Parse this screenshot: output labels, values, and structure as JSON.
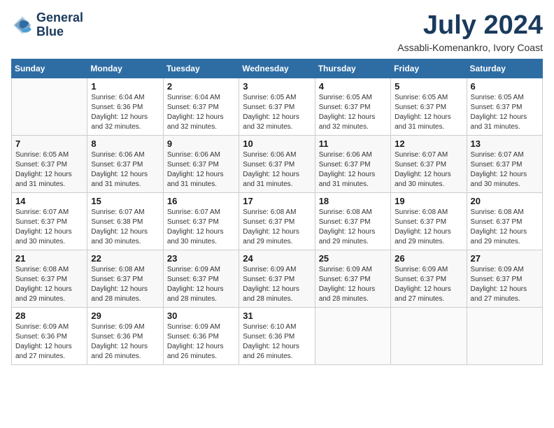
{
  "header": {
    "logo_line1": "General",
    "logo_line2": "Blue",
    "month_year": "July 2024",
    "location": "Assabli-Komenankro, Ivory Coast"
  },
  "weekdays": [
    "Sunday",
    "Monday",
    "Tuesday",
    "Wednesday",
    "Thursday",
    "Friday",
    "Saturday"
  ],
  "weeks": [
    [
      {
        "day": "",
        "info": ""
      },
      {
        "day": "1",
        "info": "Sunrise: 6:04 AM\nSunset: 6:36 PM\nDaylight: 12 hours\nand 32 minutes."
      },
      {
        "day": "2",
        "info": "Sunrise: 6:04 AM\nSunset: 6:37 PM\nDaylight: 12 hours\nand 32 minutes."
      },
      {
        "day": "3",
        "info": "Sunrise: 6:05 AM\nSunset: 6:37 PM\nDaylight: 12 hours\nand 32 minutes."
      },
      {
        "day": "4",
        "info": "Sunrise: 6:05 AM\nSunset: 6:37 PM\nDaylight: 12 hours\nand 32 minutes."
      },
      {
        "day": "5",
        "info": "Sunrise: 6:05 AM\nSunset: 6:37 PM\nDaylight: 12 hours\nand 31 minutes."
      },
      {
        "day": "6",
        "info": "Sunrise: 6:05 AM\nSunset: 6:37 PM\nDaylight: 12 hours\nand 31 minutes."
      }
    ],
    [
      {
        "day": "7",
        "info": "Sunrise: 6:05 AM\nSunset: 6:37 PM\nDaylight: 12 hours\nand 31 minutes."
      },
      {
        "day": "8",
        "info": "Sunrise: 6:06 AM\nSunset: 6:37 PM\nDaylight: 12 hours\nand 31 minutes."
      },
      {
        "day": "9",
        "info": "Sunrise: 6:06 AM\nSunset: 6:37 PM\nDaylight: 12 hours\nand 31 minutes."
      },
      {
        "day": "10",
        "info": "Sunrise: 6:06 AM\nSunset: 6:37 PM\nDaylight: 12 hours\nand 31 minutes."
      },
      {
        "day": "11",
        "info": "Sunrise: 6:06 AM\nSunset: 6:37 PM\nDaylight: 12 hours\nand 31 minutes."
      },
      {
        "day": "12",
        "info": "Sunrise: 6:07 AM\nSunset: 6:37 PM\nDaylight: 12 hours\nand 30 minutes."
      },
      {
        "day": "13",
        "info": "Sunrise: 6:07 AM\nSunset: 6:37 PM\nDaylight: 12 hours\nand 30 minutes."
      }
    ],
    [
      {
        "day": "14",
        "info": "Sunrise: 6:07 AM\nSunset: 6:37 PM\nDaylight: 12 hours\nand 30 minutes."
      },
      {
        "day": "15",
        "info": "Sunrise: 6:07 AM\nSunset: 6:38 PM\nDaylight: 12 hours\nand 30 minutes."
      },
      {
        "day": "16",
        "info": "Sunrise: 6:07 AM\nSunset: 6:37 PM\nDaylight: 12 hours\nand 30 minutes."
      },
      {
        "day": "17",
        "info": "Sunrise: 6:08 AM\nSunset: 6:37 PM\nDaylight: 12 hours\nand 29 minutes."
      },
      {
        "day": "18",
        "info": "Sunrise: 6:08 AM\nSunset: 6:37 PM\nDaylight: 12 hours\nand 29 minutes."
      },
      {
        "day": "19",
        "info": "Sunrise: 6:08 AM\nSunset: 6:37 PM\nDaylight: 12 hours\nand 29 minutes."
      },
      {
        "day": "20",
        "info": "Sunrise: 6:08 AM\nSunset: 6:37 PM\nDaylight: 12 hours\nand 29 minutes."
      }
    ],
    [
      {
        "day": "21",
        "info": "Sunrise: 6:08 AM\nSunset: 6:37 PM\nDaylight: 12 hours\nand 29 minutes."
      },
      {
        "day": "22",
        "info": "Sunrise: 6:08 AM\nSunset: 6:37 PM\nDaylight: 12 hours\nand 28 minutes."
      },
      {
        "day": "23",
        "info": "Sunrise: 6:09 AM\nSunset: 6:37 PM\nDaylight: 12 hours\nand 28 minutes."
      },
      {
        "day": "24",
        "info": "Sunrise: 6:09 AM\nSunset: 6:37 PM\nDaylight: 12 hours\nand 28 minutes."
      },
      {
        "day": "25",
        "info": "Sunrise: 6:09 AM\nSunset: 6:37 PM\nDaylight: 12 hours\nand 28 minutes."
      },
      {
        "day": "26",
        "info": "Sunrise: 6:09 AM\nSunset: 6:37 PM\nDaylight: 12 hours\nand 27 minutes."
      },
      {
        "day": "27",
        "info": "Sunrise: 6:09 AM\nSunset: 6:37 PM\nDaylight: 12 hours\nand 27 minutes."
      }
    ],
    [
      {
        "day": "28",
        "info": "Sunrise: 6:09 AM\nSunset: 6:36 PM\nDaylight: 12 hours\nand 27 minutes."
      },
      {
        "day": "29",
        "info": "Sunrise: 6:09 AM\nSunset: 6:36 PM\nDaylight: 12 hours\nand 26 minutes."
      },
      {
        "day": "30",
        "info": "Sunrise: 6:09 AM\nSunset: 6:36 PM\nDaylight: 12 hours\nand 26 minutes."
      },
      {
        "day": "31",
        "info": "Sunrise: 6:10 AM\nSunset: 6:36 PM\nDaylight: 12 hours\nand 26 minutes."
      },
      {
        "day": "",
        "info": ""
      },
      {
        "day": "",
        "info": ""
      },
      {
        "day": "",
        "info": ""
      }
    ]
  ]
}
